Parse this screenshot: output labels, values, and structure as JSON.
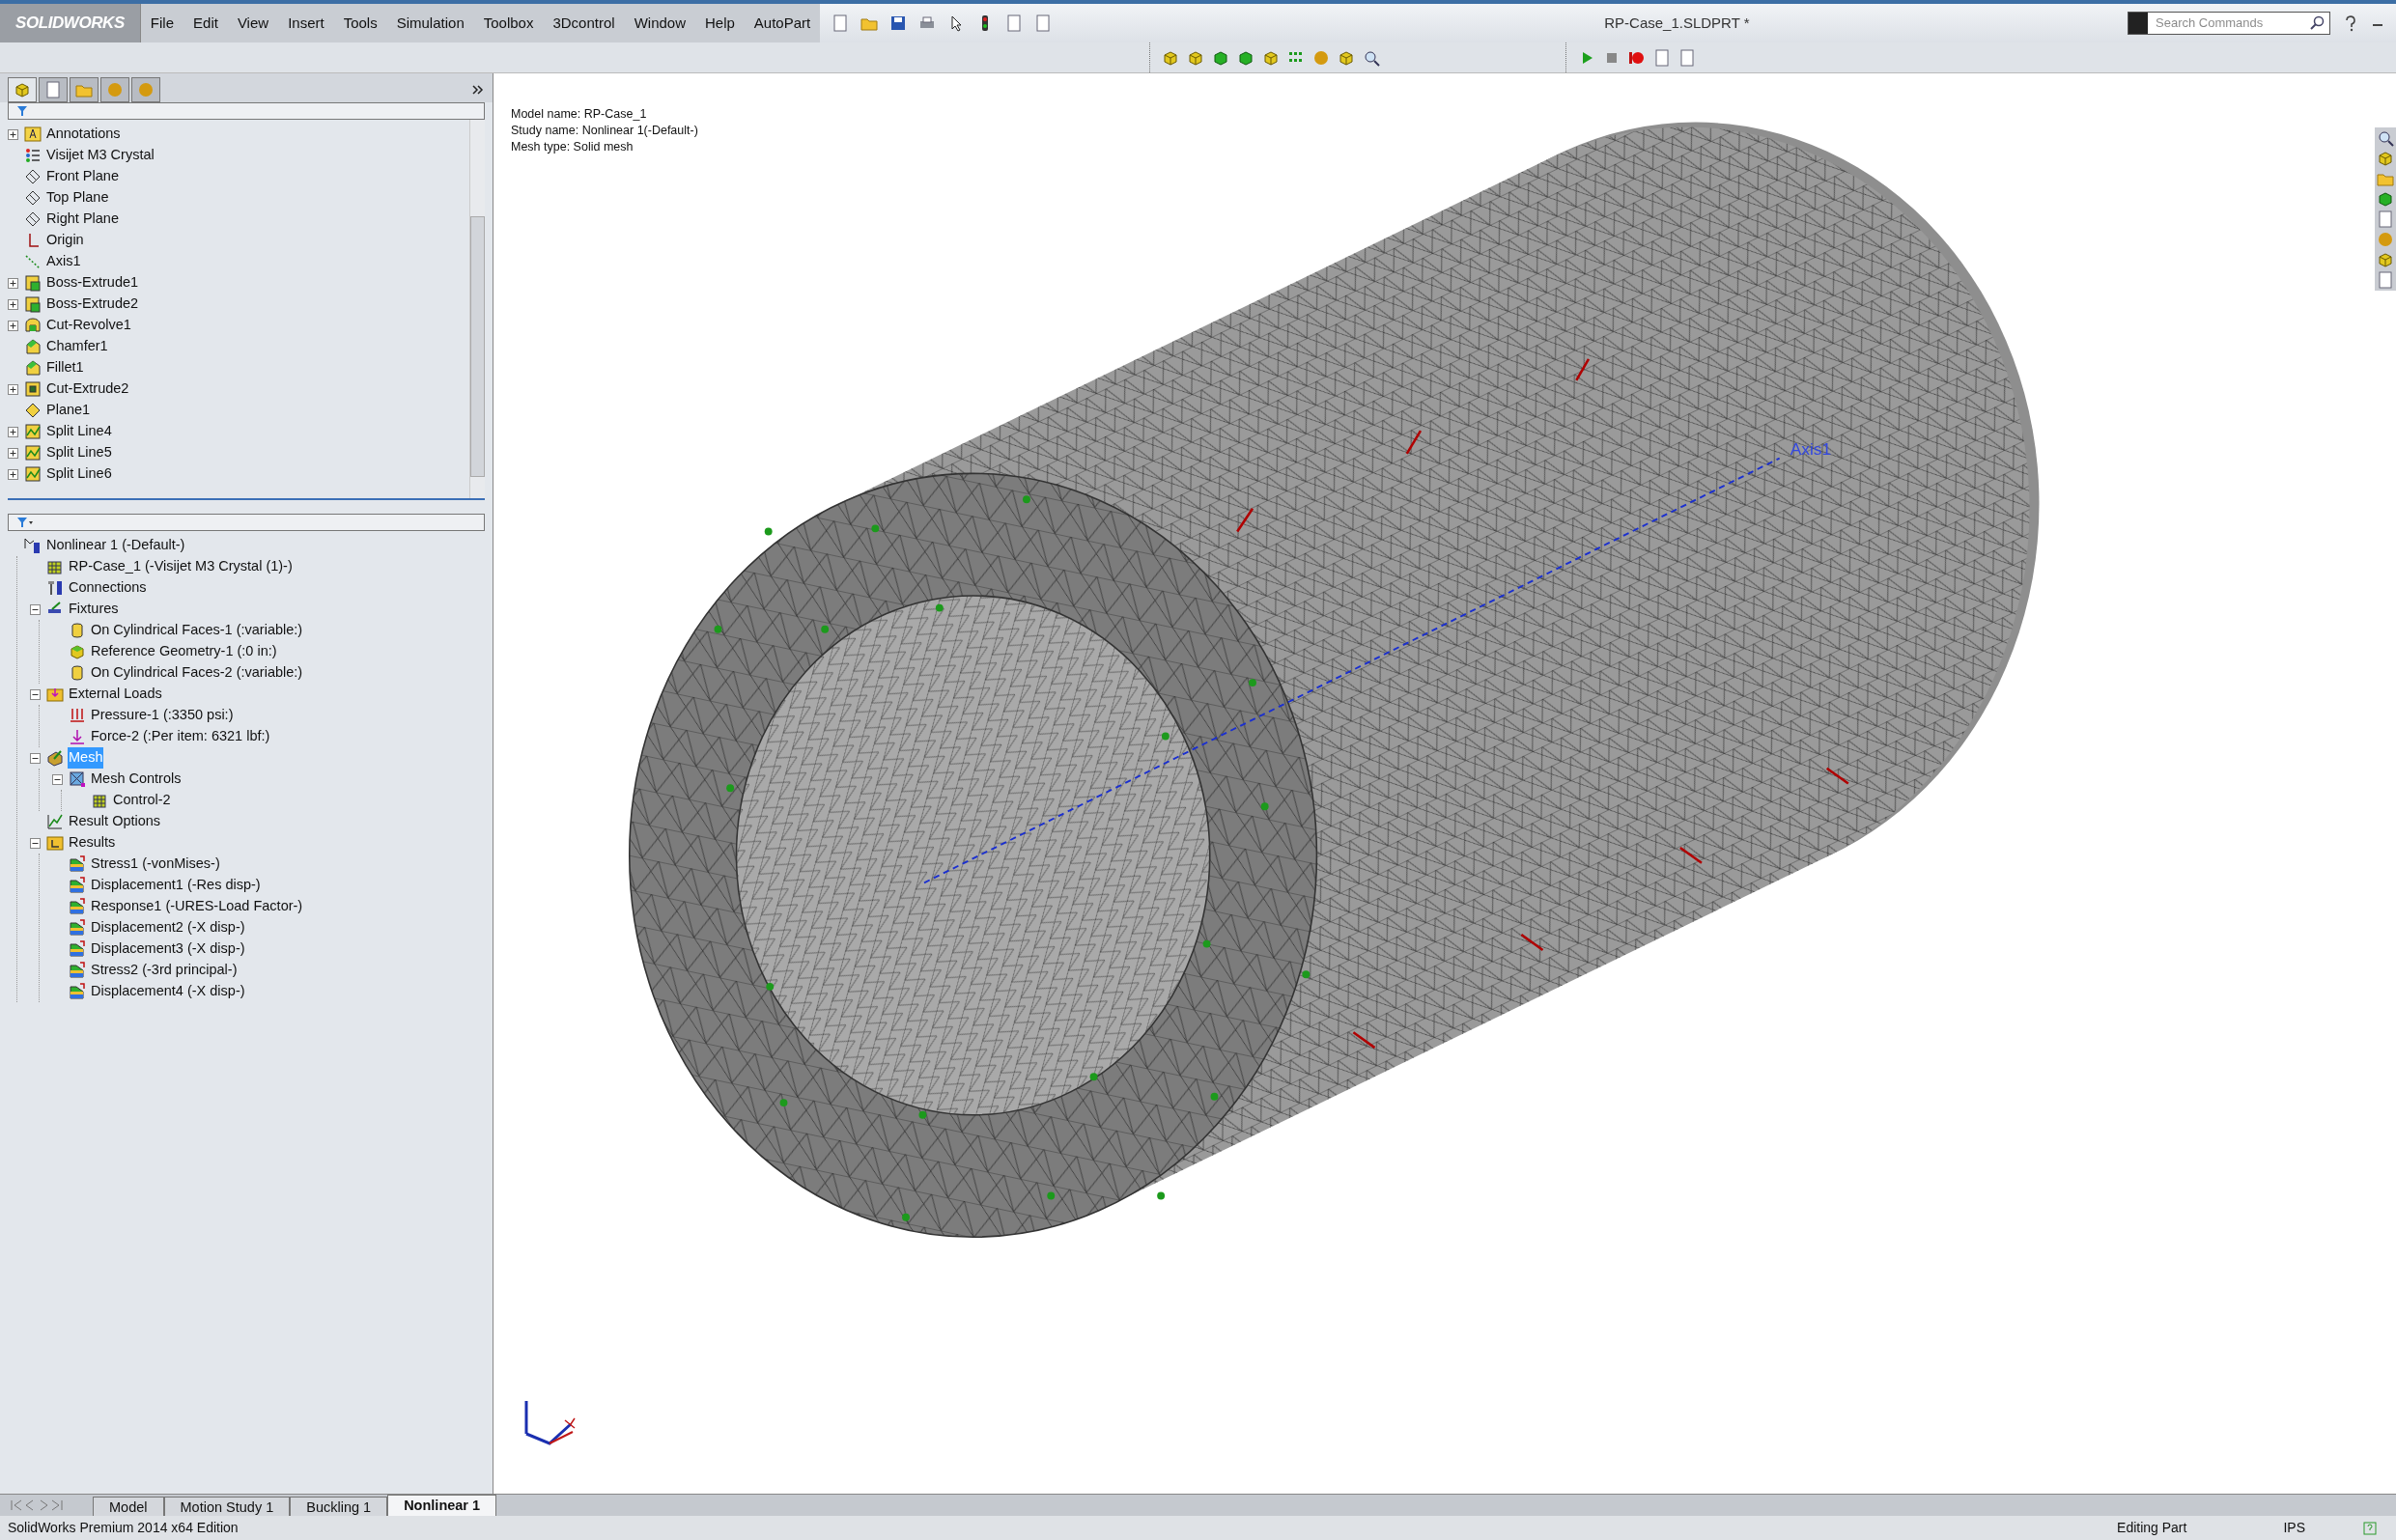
{
  "app": {
    "logo": "SOLIDWORKS",
    "menu": [
      "File",
      "Edit",
      "View",
      "Insert",
      "Tools",
      "Simulation",
      "Toolbox",
      "3Dcontrol",
      "Window",
      "Help",
      "AutoPart"
    ],
    "title": "RP-Case_1.SLDPRT *",
    "search": {
      "placeholder": "Search Commands"
    }
  },
  "feature_tree": {
    "items": [
      {
        "label": "Annotations",
        "kind": "annotations",
        "expanded": false
      },
      {
        "label": "Visijet M3 Crystal",
        "kind": "material"
      },
      {
        "label": "Front Plane",
        "kind": "plane"
      },
      {
        "label": "Top Plane",
        "kind": "plane"
      },
      {
        "label": "Right Plane",
        "kind": "plane"
      },
      {
        "label": "Origin",
        "kind": "origin"
      },
      {
        "label": "Axis1",
        "kind": "axis"
      },
      {
        "label": "Boss-Extrude1",
        "kind": "extrude",
        "expanded": false
      },
      {
        "label": "Boss-Extrude2",
        "kind": "extrude",
        "expanded": false
      },
      {
        "label": "Cut-Revolve1",
        "kind": "revolve",
        "expanded": false
      },
      {
        "label": "Chamfer1",
        "kind": "fillet"
      },
      {
        "label": "Fillet1",
        "kind": "fillet"
      },
      {
        "label": "Cut-Extrude2",
        "kind": "cut",
        "expanded": false
      },
      {
        "label": "Plane1",
        "kind": "refplane"
      },
      {
        "label": "Split Line4",
        "kind": "split",
        "expanded": false
      },
      {
        "label": "Split Line5",
        "kind": "split",
        "expanded": false
      },
      {
        "label": "Split Line6",
        "kind": "split",
        "expanded": false
      }
    ]
  },
  "study_tree": {
    "items": [
      {
        "label": "Nonlinear 1 (-Default-)",
        "kind": "study",
        "selected": false,
        "children": [
          {
            "label": "RP-Case_1 (-Visijet M3 Crystal (1)-)",
            "kind": "part",
            "selected": false
          },
          {
            "label": "Connections",
            "kind": "connection",
            "selected": false
          },
          {
            "label": "Fixtures",
            "kind": "fixtures",
            "selected": false,
            "expanded": true,
            "children": [
              {
                "label": "On Cylindrical Faces-1 (:variable:)",
                "kind": "cylinder",
                "selected": false
              },
              {
                "label": "Reference Geometry-1 (:0 in:)",
                "kind": "cube",
                "selected": false
              },
              {
                "label": "On Cylindrical Faces-2 (:variable:)",
                "kind": "cylinder",
                "selected": false
              }
            ]
          },
          {
            "label": "External Loads",
            "kind": "loads",
            "selected": false,
            "expanded": true,
            "children": [
              {
                "label": "Pressure-1 (:3350 psi:)",
                "kind": "pressure",
                "selected": false
              },
              {
                "label": "Force-2 (:Per item: 6321 lbf:)",
                "kind": "force",
                "selected": false
              }
            ]
          },
          {
            "label": "Mesh",
            "kind": "mesh",
            "selected": true,
            "expanded": true,
            "children": [
              {
                "label": "Mesh Controls",
                "kind": "meshcontrols",
                "selected": false,
                "expanded": true,
                "children": [
                  {
                    "label": "Control-2",
                    "kind": "control",
                    "selected": false
                  }
                ]
              }
            ]
          },
          {
            "label": "Result Options",
            "kind": "resultoptions",
            "selected": false
          },
          {
            "label": "Results",
            "kind": "results",
            "selected": false,
            "expanded": true,
            "children": [
              {
                "label": "Stress1 (-vonMises-)",
                "kind": "plot",
                "selected": false
              },
              {
                "label": "Displacement1 (-Res disp-)",
                "kind": "plot",
                "selected": false
              },
              {
                "label": "Response1 (-URES-Load Factor-)",
                "kind": "plot",
                "selected": false
              },
              {
                "label": "Displacement2 (-X disp-)",
                "kind": "plot",
                "selected": false
              },
              {
                "label": "Displacement3 (-X disp-)",
                "kind": "plot",
                "selected": false
              },
              {
                "label": "Stress2 (-3rd principal-)",
                "kind": "plot",
                "selected": false
              },
              {
                "label": "Displacement4 (-X disp-)",
                "kind": "plot",
                "selected": false
              }
            ]
          }
        ]
      }
    ]
  },
  "viewport": {
    "info": [
      "Model name: RP-Case_1",
      "Study name: Nonlinear 1(-Default-)",
      "Mesh type: Solid mesh"
    ],
    "axis_label": "Axis1"
  },
  "bottom_tabs": [
    {
      "label": "Model",
      "selected": false
    },
    {
      "label": "Motion Study 1",
      "selected": false
    },
    {
      "label": "Buckling 1",
      "selected": false
    },
    {
      "label": "Nonlinear 1",
      "selected": true
    }
  ],
  "status_bar": {
    "edition": "SolidWorks Premium 2014 x64 Edition",
    "mode": "Editing Part",
    "units": "IPS"
  }
}
